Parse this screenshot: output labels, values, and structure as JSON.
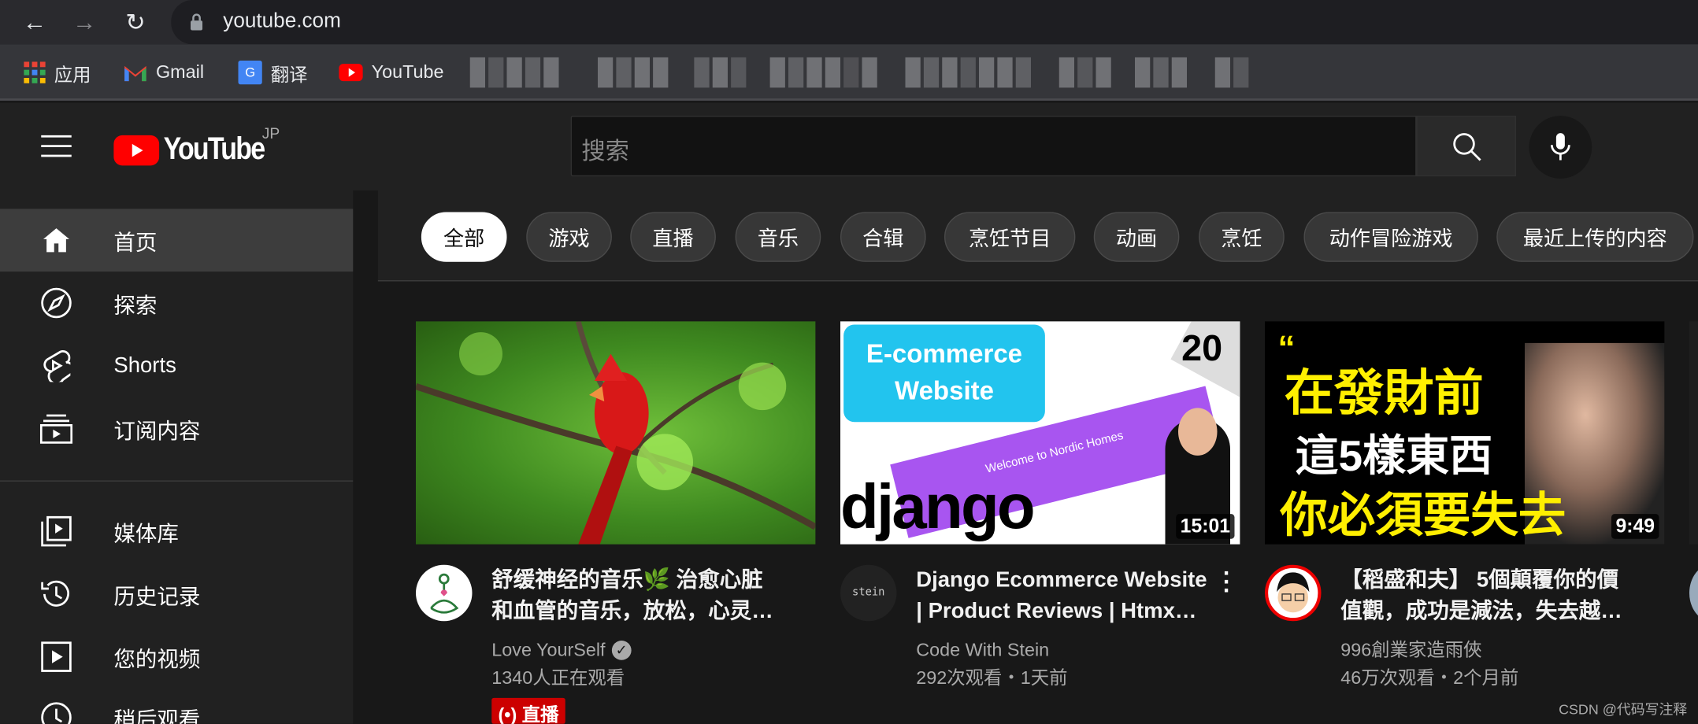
{
  "browser": {
    "url": "youtube.com",
    "icons": [
      "back-icon",
      "forward-icon",
      "reload-icon",
      "lock-icon"
    ],
    "bookmarks": [
      {
        "label": "应用",
        "icon": "apps-grid-icon"
      },
      {
        "label": "Gmail",
        "icon": "gmail-icon"
      },
      {
        "label": "翻译",
        "icon": "google-translate-icon"
      },
      {
        "label": "YouTube",
        "icon": "youtube-icon"
      }
    ]
  },
  "masthead": {
    "logo_text": "YouTube",
    "region": "JP",
    "search_placeholder": "搜索",
    "brand_color": "#ff0000"
  },
  "sidebar": {
    "items": [
      {
        "label": "首页",
        "icon": "home-icon",
        "selected": true
      },
      {
        "label": "探索",
        "icon": "compass-icon"
      },
      {
        "label": "Shorts",
        "icon": "shorts-icon"
      },
      {
        "label": "订阅内容",
        "icon": "subscriptions-icon"
      },
      {
        "label": "媒体库",
        "icon": "library-icon"
      },
      {
        "label": "历史记录",
        "icon": "history-icon"
      },
      {
        "label": "您的视频",
        "icon": "your-videos-icon"
      },
      {
        "label": "稍后观看",
        "icon": "watch-later-icon"
      }
    ]
  },
  "chips": [
    "全部",
    "游戏",
    "直播",
    "音乐",
    "合辑",
    "烹饪节目",
    "动画",
    "烹饪",
    "动作冒险游戏",
    "最近上传的内容"
  ],
  "videos": [
    {
      "title_line1": "舒缓神经的音乐🌿 治愈心脏",
      "title_line2": "和血管的音乐，放松，心灵…",
      "channel": "Love YourSelf",
      "verified": true,
      "stats": "1340人正在观看",
      "badge": "直播",
      "badge_icon": "live-broadcast-icon"
    },
    {
      "title_line1": "Django Ecommerce Website",
      "title_line2": "| Product Reviews | Htmx…",
      "channel": "Code With Stein",
      "stats": "292次观看・1天前",
      "duration": "15:01",
      "thumb_text": {
        "box": "E-commerce Website",
        "corner": "20",
        "logo": "django",
        "site": "Welcome to Nordic Homes"
      },
      "avatar_text": "stein"
    },
    {
      "title_line1": "【稻盛和夫】 5個顛覆你的價",
      "title_line2": "值觀，成功是減法，失去越…",
      "channel": "996創業家造雨俠",
      "stats": "46万次观看・2个月前",
      "duration": "9:49",
      "thumb_text": {
        "line1": "在發財前",
        "line2": "這5樣東西",
        "line3": "你必須要失去"
      }
    }
  ],
  "watermark": "CSDN @代码写注释"
}
